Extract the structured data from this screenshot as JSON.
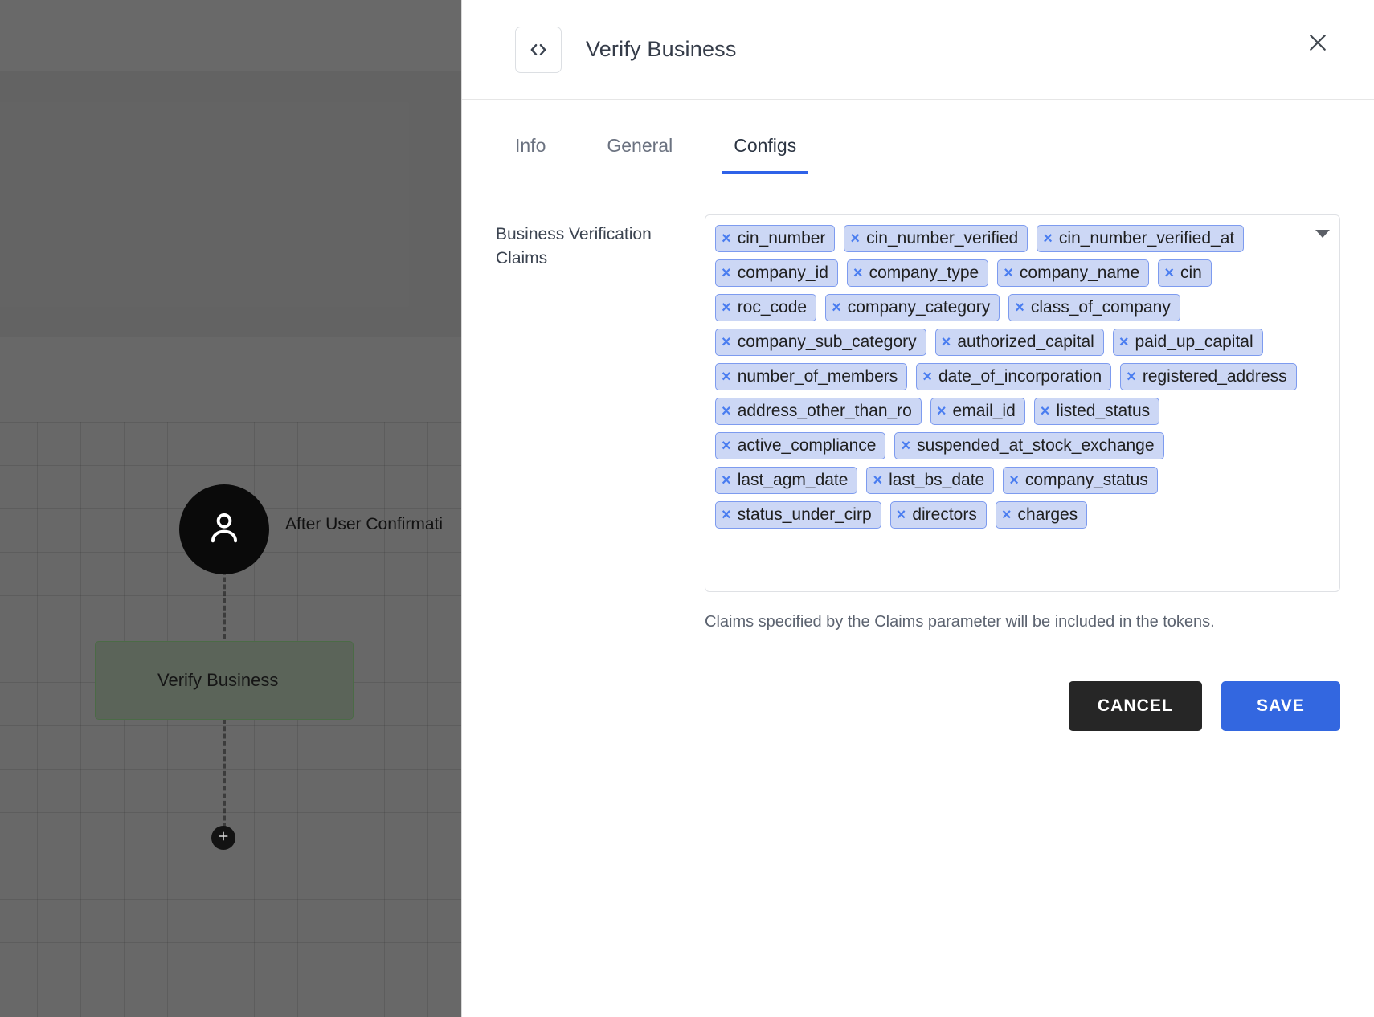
{
  "canvas": {
    "user_node_icon": "person-icon",
    "edge_label": "After User Confirmati",
    "verify_node_label": "Verify Business",
    "add_node_icon": "plus-icon"
  },
  "panel": {
    "icon": "code-brackets-icon",
    "title": "Verify Business",
    "close_icon": "close-icon",
    "tabs": [
      {
        "label": "Info",
        "active": false
      },
      {
        "label": "General",
        "active": false
      },
      {
        "label": "Configs",
        "active": true
      }
    ],
    "field": {
      "label": "Business Verification Claims",
      "caret_icon": "chevron-down-icon",
      "chips": [
        "cin_number",
        "cin_number_verified",
        "cin_number_verified_at",
        "company_id",
        "company_type",
        "company_name",
        "cin",
        "roc_code",
        "company_category",
        "class_of_company",
        "company_sub_category",
        "authorized_capital",
        "paid_up_capital",
        "number_of_members",
        "date_of_incorporation",
        "registered_address",
        "address_other_than_ro",
        "email_id",
        "listed_status",
        "active_compliance",
        "suspended_at_stock_exchange",
        "last_agm_date",
        "last_bs_date",
        "company_status",
        "status_under_cirp",
        "directors",
        "charges"
      ],
      "chip_remove_glyph": "×",
      "helper_text": "Claims specified by the Claims parameter will be included in the tokens."
    },
    "actions": {
      "cancel_label": "CANCEL",
      "save_label": "SAVE"
    }
  },
  "colors": {
    "accent": "#3367e0",
    "tab_underline": "#2f62e8",
    "chip_bg": "#ccd7f5",
    "chip_border": "#7d9bef",
    "chip_x": "#4a7df0",
    "cancel_bg": "#262626",
    "node_green": "#5b6459"
  }
}
